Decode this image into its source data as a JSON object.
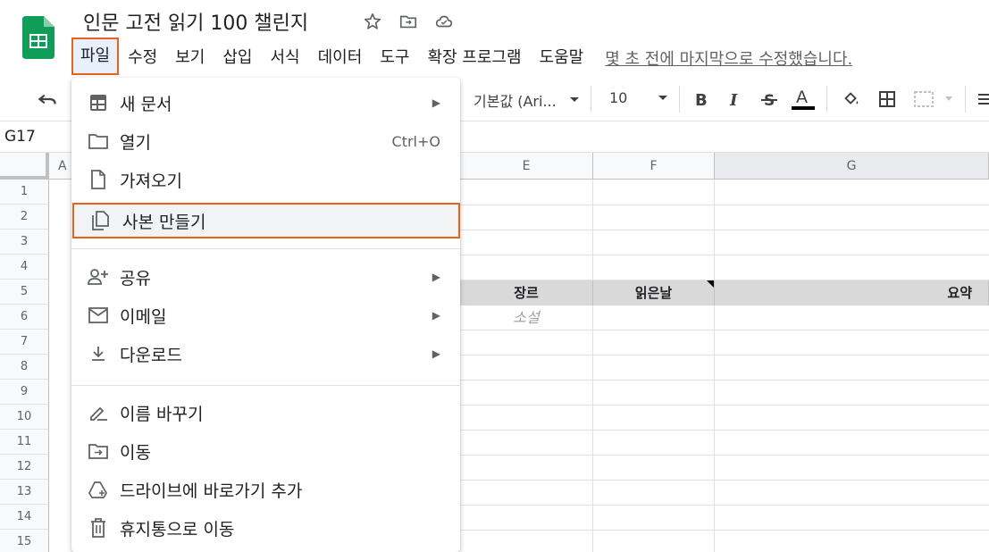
{
  "document": {
    "title": "인문 고전 읽기 100 챌린지",
    "last_edit": "몇 초 전에 마지막으로 수정했습니다."
  },
  "menubar": {
    "items": [
      "파일",
      "수정",
      "보기",
      "삽입",
      "서식",
      "데이터",
      "도구",
      "확장 프로그램",
      "도움말"
    ]
  },
  "toolbar": {
    "font": "기본값 (Ari...",
    "font_size": "10"
  },
  "namebox": {
    "value": "G17"
  },
  "grid": {
    "columns": [
      "A",
      "E",
      "F",
      "G"
    ],
    "rows": [
      "1",
      "2",
      "3",
      "4",
      "5",
      "6",
      "7",
      "8",
      "9",
      "10",
      "11",
      "12",
      "13",
      "14",
      "15"
    ],
    "headers": {
      "genre": "장르",
      "read_date": "읽은날",
      "summary": "요약"
    },
    "genre_cell": "소설"
  },
  "file_menu": {
    "items": [
      {
        "label": "새 문서",
        "icon": "new-sheet-icon",
        "submenu": true
      },
      {
        "label": "열기",
        "icon": "folder-icon",
        "shortcut": "Ctrl+O"
      },
      {
        "label": "가져오기",
        "icon": "file-icon"
      },
      {
        "label": "사본 만들기",
        "icon": "copy-icon"
      },
      {
        "label": "공유",
        "icon": "share-person-icon",
        "submenu": true
      },
      {
        "label": "이메일",
        "icon": "mail-icon",
        "submenu": true
      },
      {
        "label": "다운로드",
        "icon": "download-icon",
        "submenu": true
      },
      {
        "label": "이름 바꾸기",
        "icon": "rename-icon"
      },
      {
        "label": "이동",
        "icon": "move-folder-icon"
      },
      {
        "label": "드라이브에 바로가기 추가",
        "icon": "drive-shortcut-icon"
      },
      {
        "label": "휴지통으로 이동",
        "icon": "trash-icon"
      }
    ]
  },
  "colors": {
    "accent": "#e8631a",
    "sheets_green": "#0f9d58",
    "header_gray": "#d9d9d9"
  }
}
